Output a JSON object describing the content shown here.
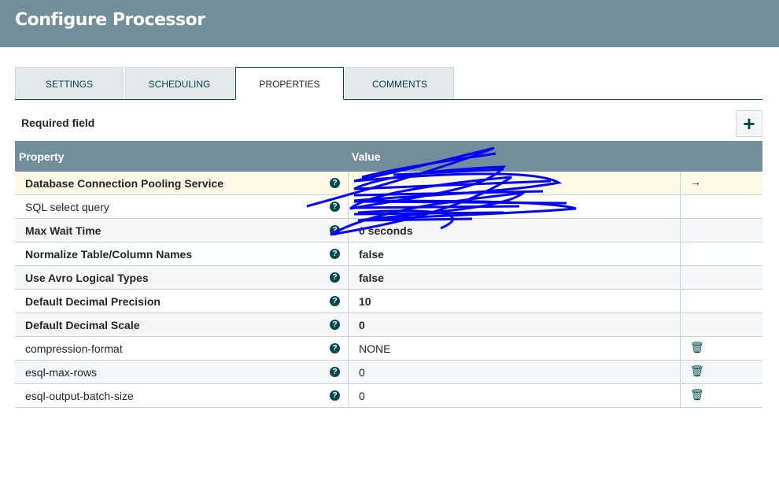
{
  "title": "Configure Processor",
  "tabs": [
    {
      "label": "SETTINGS"
    },
    {
      "label": "SCHEDULING"
    },
    {
      "label": "PROPERTIES"
    },
    {
      "label": "COMMENTS"
    }
  ],
  "required_label": "Required field",
  "add_label": "+",
  "columns": {
    "property": "Property",
    "value": "Value"
  },
  "rows": [
    {
      "name": "Database Connection Pooling Service",
      "value": "",
      "required": true,
      "action": "→"
    },
    {
      "name": "SQL select query",
      "value": "",
      "required": false,
      "action": ""
    },
    {
      "name": "Max Wait Time",
      "value": "0 seconds",
      "required": true,
      "action": ""
    },
    {
      "name": "Normalize Table/Column Names",
      "value": "false",
      "required": true,
      "action": ""
    },
    {
      "name": "Use Avro Logical Types",
      "value": "false",
      "required": true,
      "action": ""
    },
    {
      "name": "Default Decimal Precision",
      "value": "10",
      "required": true,
      "action": ""
    },
    {
      "name": "Default Decimal Scale",
      "value": "0",
      "required": true,
      "action": ""
    },
    {
      "name": "compression-format",
      "value": "NONE",
      "required": false,
      "action": "🗑"
    },
    {
      "name": "esql-max-rows",
      "value": "0",
      "required": false,
      "action": "🗑"
    },
    {
      "name": "esql-output-batch-size",
      "value": "0",
      "required": false,
      "action": "🗑"
    }
  ],
  "help_glyph": "?",
  "colors": {
    "header": "#728e9b",
    "accent": "#004849",
    "selected_row": "#fef9e6",
    "scribble": "#0000ff"
  }
}
